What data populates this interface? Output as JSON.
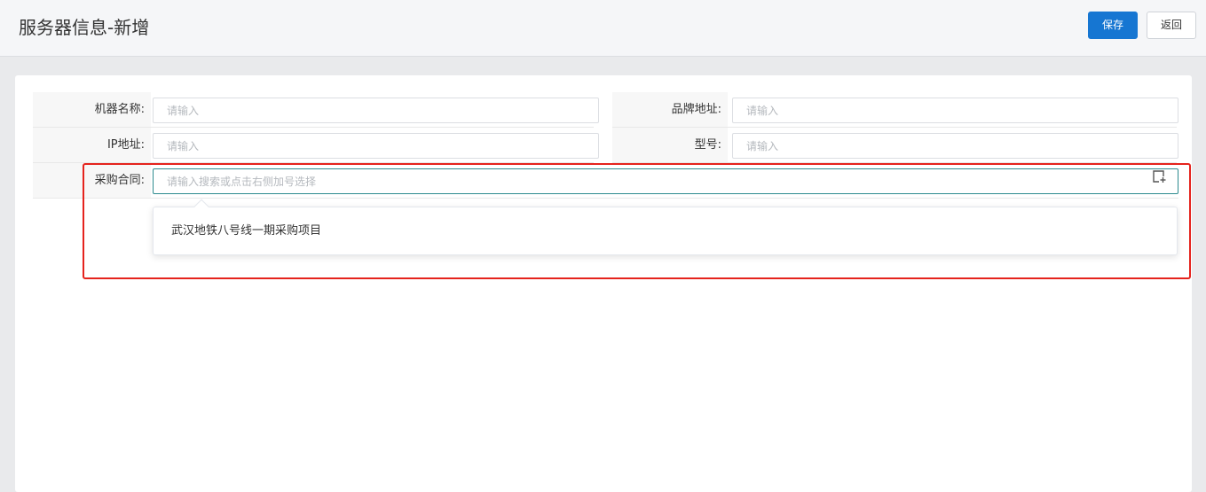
{
  "header": {
    "title": "服务器信息-新增",
    "save_label": "保存",
    "back_label": "返回"
  },
  "form": {
    "machine_name": {
      "label": "机器名称:",
      "placeholder": "请输入",
      "value": ""
    },
    "brand_address": {
      "label": "品牌地址:",
      "placeholder": "请输入",
      "value": ""
    },
    "ip_address": {
      "label": "IP地址:",
      "placeholder": "请输入",
      "value": ""
    },
    "model": {
      "label": "型号:",
      "placeholder": "请输入",
      "value": ""
    },
    "purchase_contract": {
      "label": "采购合同:",
      "placeholder": "请输入搜索或点击右侧加号选择",
      "value": "",
      "icon": "add-box-icon"
    }
  },
  "dropdown": {
    "options": [
      "武汉地铁八号线一期采购项目"
    ]
  },
  "colors": {
    "primary": "#1676d2",
    "focus_border": "#2d8b8f",
    "annotation": "#e5231d",
    "label_bg": "#f7f7f7"
  }
}
